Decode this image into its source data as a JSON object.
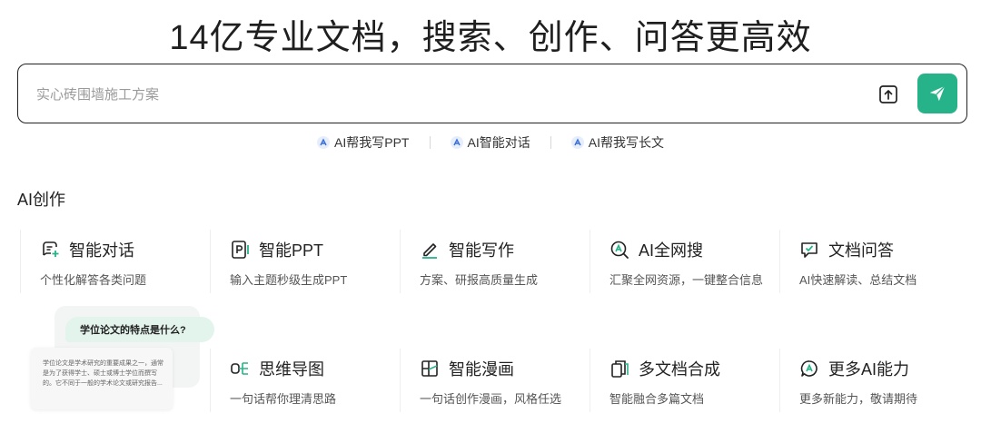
{
  "headline": "14亿专业文档，搜索、创作、问答更高效",
  "search": {
    "placeholder": "实心砖围墙施工方案",
    "value": ""
  },
  "quick_links": [
    {
      "label": "AI帮我写PPT",
      "icon": "ai-badge-icon"
    },
    {
      "label": "AI智能对话",
      "icon": "ai-badge-icon"
    },
    {
      "label": "AI帮我写长文",
      "icon": "ai-badge-icon"
    }
  ],
  "section_title": "AI创作",
  "cards": [
    {
      "title": "智能对话",
      "desc": "个性化解答各类问题",
      "icon": "chat-plus-icon"
    },
    {
      "title": "智能PPT",
      "desc": "输入主题秒级生成PPT",
      "icon": "ppt-icon"
    },
    {
      "title": "智能写作",
      "desc": "方案、研报高质量生成",
      "icon": "pen-icon"
    },
    {
      "title": "AI全网搜",
      "desc": "汇聚全网资源，一键整合信息",
      "icon": "web-search-icon"
    },
    {
      "title": "文档问答",
      "desc": "AI快速解读、总结文档",
      "icon": "doc-chat-icon"
    },
    {
      "title": "思维导图",
      "desc": "一句话帮你理清思路",
      "icon": "mindmap-icon"
    },
    {
      "title": "智能漫画",
      "desc": "一句话创作漫画，风格任选",
      "icon": "comic-icon"
    },
    {
      "title": "多文档合成",
      "desc": "智能融合多篇文档",
      "icon": "multi-doc-icon"
    },
    {
      "title": "更多AI能力",
      "desc": "更多新能力，敬请期待",
      "icon": "more-ai-icon"
    }
  ],
  "illustration": {
    "question": "学位论文的特点是什么?",
    "answer": "学位论文是学术研究的重要成果之一，通常是为了获得学士、硕士或博士学位而撰写的。它不同于一般的学术论文或研究报告..."
  },
  "colors": {
    "accent": "#27b389",
    "text": "#222222",
    "muted": "#555555"
  }
}
